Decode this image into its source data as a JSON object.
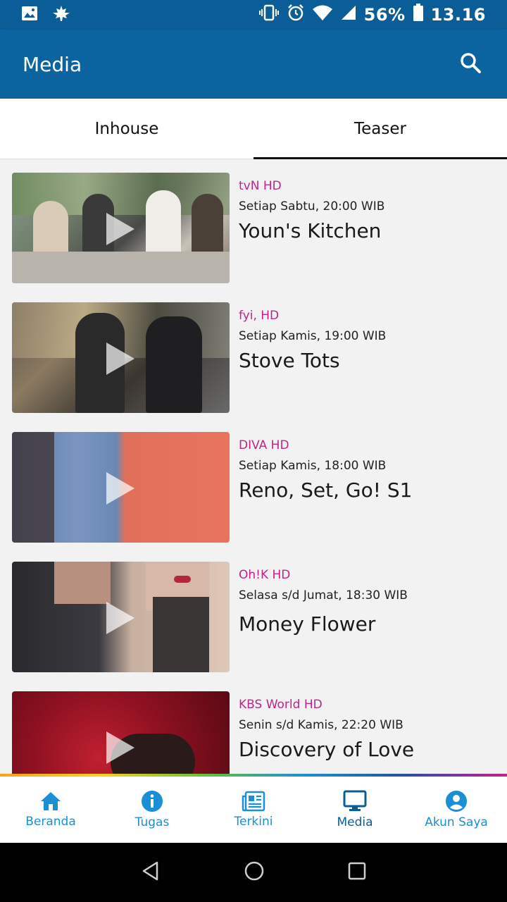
{
  "status_bar": {
    "battery_percent": "56%",
    "time": "13.16"
  },
  "app_bar": {
    "title": "Media"
  },
  "tabs": [
    {
      "label": "Inhouse",
      "active": false
    },
    {
      "label": "Teaser",
      "active": true
    }
  ],
  "media_items": [
    {
      "channel": "tvN HD",
      "schedule": "Setiap Sabtu, 20:00 WIB",
      "title": "Youn's Kitchen"
    },
    {
      "channel": "fyi, HD",
      "schedule": "Setiap Kamis, 19:00 WIB",
      "title": "Stove Tots"
    },
    {
      "channel": "DIVA HD",
      "schedule": "Setiap Kamis, 18:00 WIB",
      "title": "Reno, Set, Go! S1"
    },
    {
      "channel": "Oh!K HD",
      "schedule": "Selasa s/d Jumat, 18:30 WIB",
      "title": "Money Flower"
    },
    {
      "channel": "KBS World HD",
      "schedule": "Senin s/d Kamis, 22:20 WIB",
      "title": "Discovery of Love"
    }
  ],
  "bottom_nav": [
    {
      "label": "Beranda",
      "icon": "home-icon"
    },
    {
      "label": "Tugas",
      "icon": "info-icon"
    },
    {
      "label": "Terkini",
      "icon": "news-icon"
    },
    {
      "label": "Media",
      "icon": "monitor-icon",
      "active": true
    },
    {
      "label": "Akun Saya",
      "icon": "account-icon"
    }
  ],
  "colors": {
    "primary": "#0b64a0",
    "channel_text": "#c0248a",
    "nav_label": "#1a8fd6"
  }
}
